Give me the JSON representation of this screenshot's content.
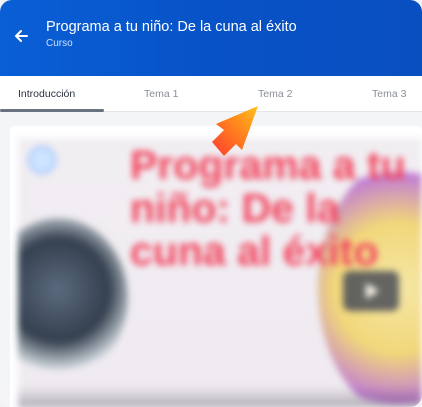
{
  "header": {
    "title": "Programa a tu niño: De la cuna al éxito",
    "subtitle": "Curso",
    "background_color": "#0752c7",
    "back_icon": "arrow-left-icon"
  },
  "tabs": [
    {
      "label": "Introducción",
      "active": true
    },
    {
      "label": "Tema 1",
      "active": false
    },
    {
      "label": "Tema 2",
      "active": false
    },
    {
      "label": "Tema 3",
      "active": false
    }
  ],
  "video": {
    "thumbnail_title": "Programa a tu niño: De la cuna al éxito",
    "play_icon": "play-icon",
    "title_color": "#f2445d"
  },
  "annotation": {
    "arrow_icon": "pointer-arrow-icon",
    "arrow_color": "#ff9a1f"
  }
}
